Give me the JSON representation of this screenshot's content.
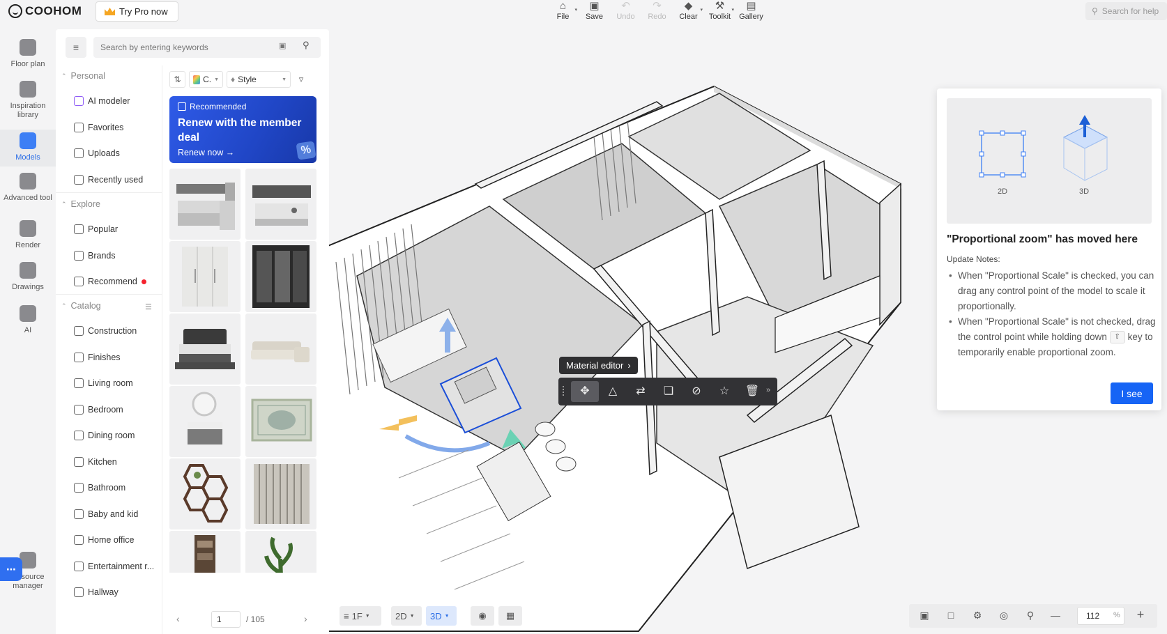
{
  "app": {
    "brand": "COOHOM",
    "try_pro": "Try Pro now",
    "help_placeholder": "Search for help"
  },
  "toolbar": [
    {
      "label": "File",
      "icon": "home-icon",
      "disabled": false,
      "caret": true
    },
    {
      "label": "Save",
      "icon": "save-icon",
      "disabled": false,
      "caret": false
    },
    {
      "label": "Undo",
      "icon": "undo-icon",
      "disabled": true,
      "caret": false
    },
    {
      "label": "Redo",
      "icon": "redo-icon",
      "disabled": true,
      "caret": false
    },
    {
      "label": "Clear",
      "icon": "eraser-icon",
      "disabled": false,
      "caret": true
    },
    {
      "label": "Toolkit",
      "icon": "wrench-icon",
      "disabled": false,
      "caret": true
    },
    {
      "label": "Gallery",
      "icon": "gallery-icon",
      "disabled": false,
      "caret": false
    }
  ],
  "rail": [
    {
      "label": "Floor plan",
      "active": false
    },
    {
      "label": "Inspiration library",
      "active": false
    },
    {
      "label": "Models",
      "active": true
    },
    {
      "label": "Advanced tool",
      "active": false
    },
    {
      "label": "Render",
      "active": false
    },
    {
      "label": "Drawings",
      "active": false
    },
    {
      "label": "AI",
      "active": false
    },
    {
      "label": "Resource manager",
      "active": false
    }
  ],
  "panel": {
    "search_placeholder": "Search by entering keywords",
    "personal_header": "Personal",
    "personal": [
      "AI modeler",
      "Favorites",
      "Uploads",
      "Recently used"
    ],
    "explore_header": "Explore",
    "explore": [
      "Popular",
      "Brands",
      "Recommend"
    ],
    "catalog_header": "Catalog",
    "catalog": [
      "Construction",
      "Finishes",
      "Living room",
      "Bedroom",
      "Dining room",
      "Kitchen",
      "Bathroom",
      "Baby and kid",
      "Home office",
      "Entertainment r...",
      "Hallway"
    ],
    "filter_color": "C.",
    "filter_style": "Style"
  },
  "banner": {
    "tag": "Recommended",
    "headline": "Renew with the member deal",
    "cta": "Renew now →",
    "badge": "%"
  },
  "pager": {
    "current": "1",
    "total": "/ 105"
  },
  "material_editor": {
    "label": "Material editor",
    "tools": [
      "move-icon",
      "mirror-icon",
      "swap-icon",
      "duplicate-icon",
      "hide-icon",
      "favorite-icon",
      "delete-icon"
    ]
  },
  "popup": {
    "illu_2d": "2D",
    "illu_3d": "3D",
    "title": "\"Proportional zoom\" has moved here",
    "subtitle": "Update Notes:",
    "note1": "When \"Proportional Scale\" is checked, you can drag any control point of the model to scale it proportionally.",
    "note2_before": "When \"Proportional Scale\" is not checked, drag the control point while holding down",
    "note2_key": "⇧",
    "note2_after": "key to temporarily enable proportional zoom.",
    "button": "I see"
  },
  "bottom": {
    "floor": "1F",
    "mode_2d": "2D",
    "mode_3d": "3D",
    "zoom": "112",
    "zoom_unit": "%"
  }
}
